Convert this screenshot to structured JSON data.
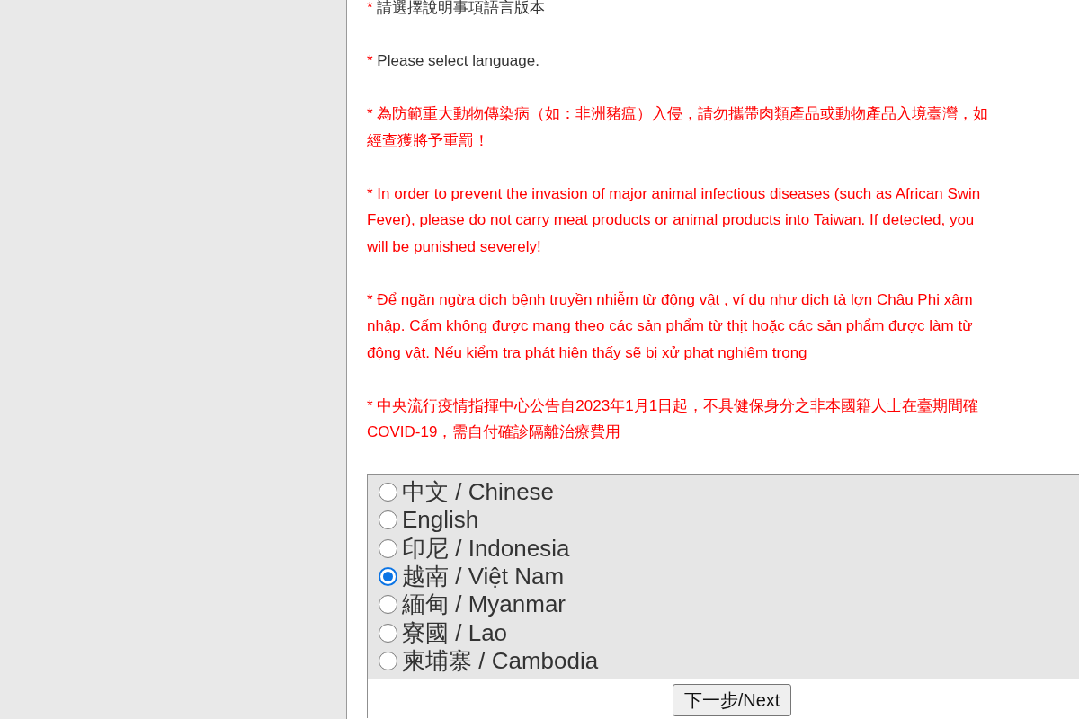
{
  "notices": [
    {
      "kind": "plain",
      "marker": "*",
      "lines": [
        "請選擇說明事項語言版本"
      ]
    },
    {
      "kind": "plain",
      "marker": "*",
      "lines": [
        "Please select language."
      ]
    },
    {
      "kind": "warning",
      "marker": "*",
      "lines": [
        "為防範重大動物傳染病（如：非洲豬瘟）入侵，請勿攜帶肉類產品或動物產品入境臺灣，如",
        "經查獲將予重罰！"
      ]
    },
    {
      "kind": "warning",
      "marker": "*",
      "lines": [
        "In order to prevent the invasion of major animal infectious diseases (such as African Swin",
        "Fever), please do not carry meat products or animal products into Taiwan. If detected, you",
        "will be punished severely!"
      ]
    },
    {
      "kind": "warning",
      "marker": "*",
      "lines": [
        "Để ngăn ngừa dịch bệnh truyền nhiễm từ động vật , ví dụ như dịch tả lợn Châu Phi xâm",
        "nhập. Cấm không được mang theo các sản phẩm từ thịt hoặc các sản phẩm được làm từ",
        "động vật. Nếu kiểm tra phát hiện thấy sẽ bị xử phạt nghiêm trọng"
      ]
    },
    {
      "kind": "warning",
      "marker": "*",
      "lines": [
        "中央流行疫情指揮中心公告自2023年1月1日起，不具健保身分之非本國籍人士在臺期間確",
        "COVID-19，需自付確診隔離治療費用"
      ]
    }
  ],
  "languages": [
    {
      "label": "中文 / Chinese",
      "selected": false
    },
    {
      "label": "English",
      "selected": false
    },
    {
      "label": "印尼 / Indonesia",
      "selected": false
    },
    {
      "label": "越南 / Việt Nam",
      "selected": true
    },
    {
      "label": "緬甸 / Myanmar",
      "selected": false
    },
    {
      "label": "寮國 / Lao",
      "selected": false
    },
    {
      "label": "柬埔寨 / Cambodia",
      "selected": false
    }
  ],
  "next_button": "下一步/Next"
}
